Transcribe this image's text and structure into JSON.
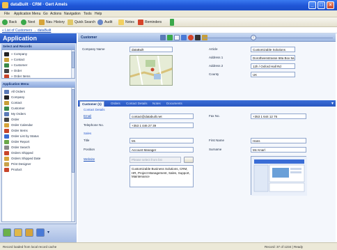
{
  "window": {
    "title": "dataBuilt · CRM · Gert Amels",
    "accent": "#1f55d6"
  },
  "menubar": {
    "items": [
      "File",
      "Application Menu",
      "Go",
      "Actions",
      "Navigation",
      "Tools",
      "Help"
    ]
  },
  "toolbar": {
    "buttons": [
      {
        "label": "Back",
        "icon": "back-arrow-icon"
      },
      {
        "label": "Next",
        "icon": "forward-arrow-icon"
      },
      {
        "label": "Nav. History",
        "icon": "history-icon"
      },
      {
        "label": "Quick Search",
        "icon": "search-icon"
      },
      {
        "label": "Audit",
        "icon": "audit-icon"
      },
      {
        "label": "Notes",
        "icon": "notes-icon"
      },
      {
        "label": "Reminders",
        "icon": "reminders-icon"
      }
    ]
  },
  "breadcrumb": {
    "text": "« List of Customers → dataBuilt"
  },
  "sidebar": {
    "title": "Application",
    "panel1": {
      "title": "Select and Records",
      "items": [
        {
          "label": "» Company",
          "color": "#222222"
        },
        {
          "label": "» Contact",
          "color": "#c89f3a"
        },
        {
          "label": "» Customer",
          "color": "#3a8a4a"
        },
        {
          "label": "» Order",
          "color": "#444444"
        },
        {
          "label": "» Order Items",
          "color": "#c8452a"
        }
      ]
    },
    "panel2": {
      "title": "Application Menu",
      "items": [
        {
          "label": "All Orders",
          "color": "#5a7ab8"
        },
        {
          "label": "Company",
          "color": "#222222"
        },
        {
          "label": "Contact",
          "color": "#c89f3a"
        },
        {
          "label": "Customer",
          "color": "#3a8a4a"
        },
        {
          "label": "My Orders",
          "color": "#5a7ab8"
        },
        {
          "label": "Order",
          "color": "#444444"
        },
        {
          "label": "Order Calendar",
          "color": "#d6a43a"
        },
        {
          "label": "Order Items",
          "color": "#c8452a"
        },
        {
          "label": "Order List by Status",
          "color": "#3a6ad0"
        },
        {
          "label": "Order Report",
          "color": "#6aa84a"
        },
        {
          "label": "Order Search",
          "color": "#8a8a8a"
        },
        {
          "label": "Orders Shipped",
          "color": "#c8452a"
        },
        {
          "label": "Orders Shipped Date",
          "color": "#d6a43a"
        },
        {
          "label": "Print Designer",
          "color": "#c8a24a"
        },
        {
          "label": "Product",
          "color": "#c8452a"
        }
      ]
    }
  },
  "main": {
    "header_title": "Customer",
    "fields": {
      "company_name_label": "Company Name",
      "company_name_value": "dataBuilt",
      "article_label": "Article",
      "article_value": "Customizable Solutions",
      "address1_label": "Address 1",
      "address1_value": "Dorotheenstrasse 68a Box 5a",
      "address2_label": "Address 2",
      "address2_value": "12h / Oxford Hall Rd",
      "county_label": "County",
      "county_value": "UK"
    },
    "tabs": [
      "Customer (1)",
      "Orders",
      "Contact Details",
      "Notes",
      "Documents"
    ],
    "contact": {
      "section_contact": "Contact Details",
      "email_label": "Email",
      "email_value": "contact@databuilt.net",
      "fax_label": "Fax No.",
      "fax_value": "+353 1 644 12 76",
      "telephone_label": "Telephone No.",
      "telephone_value": "+353 1 446 27 39",
      "section_sales": "Sales",
      "title_label": "Title",
      "title_value": "Mr.",
      "first_name_label": "First Name",
      "first_name_value": "Hans",
      "position_label": "Position",
      "position_value": "Account Manager",
      "surname_label": "Surname",
      "surname_value": "Mc Knarl",
      "website_label": "Website",
      "website_placeholder": "Please select from list",
      "notes_value": "Customizable Business Solutions, CRM, HR, Project Management, Sales, Support, Maintenance"
    }
  },
  "statusbar": {
    "left": "Record loaded from local record cache",
    "right": "Record: 37 of 1234   |   Ready"
  }
}
